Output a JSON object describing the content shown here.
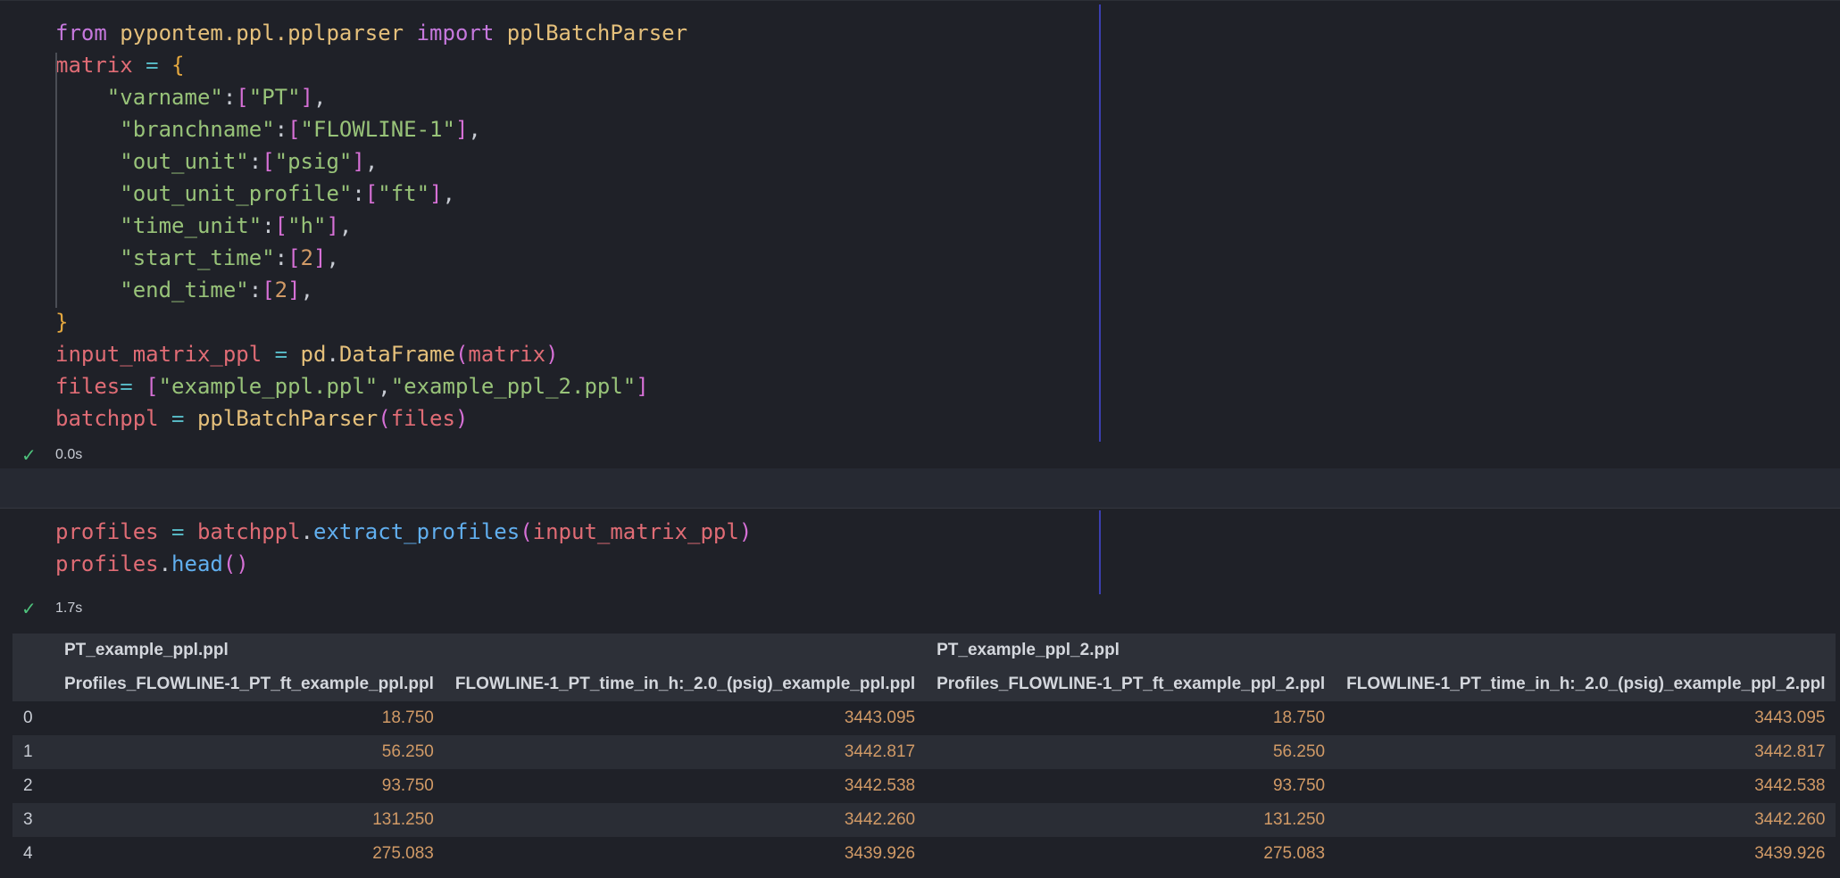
{
  "cell1": {
    "status_time": "0.0s",
    "code_lines": [
      [
        [
          "kw",
          "from "
        ],
        [
          "mod",
          "pypontem.ppl.pplparser "
        ],
        [
          "kw",
          "import "
        ],
        [
          "mod",
          "pplBatchParser"
        ]
      ],
      [
        [
          "var",
          "matrix "
        ],
        [
          "op",
          "= "
        ],
        [
          "br1",
          "{"
        ]
      ],
      [
        [
          "pun",
          "    "
        ],
        [
          "str",
          "\"varname\""
        ],
        [
          "pun",
          ":"
        ],
        [
          "br2",
          "["
        ],
        [
          "str",
          "\"PT\""
        ],
        [
          "br2",
          "]"
        ],
        [
          "pun",
          ","
        ]
      ],
      [
        [
          "pun",
          "     "
        ],
        [
          "str",
          "\"branchname\""
        ],
        [
          "pun",
          ":"
        ],
        [
          "br2",
          "["
        ],
        [
          "str",
          "\"FLOWLINE-1\""
        ],
        [
          "br2",
          "]"
        ],
        [
          "pun",
          ","
        ]
      ],
      [
        [
          "pun",
          "     "
        ],
        [
          "str",
          "\"out_unit\""
        ],
        [
          "pun",
          ":"
        ],
        [
          "br2",
          "["
        ],
        [
          "str",
          "\"psig\""
        ],
        [
          "br2",
          "]"
        ],
        [
          "pun",
          ","
        ]
      ],
      [
        [
          "pun",
          "     "
        ],
        [
          "str",
          "\"out_unit_profile\""
        ],
        [
          "pun",
          ":"
        ],
        [
          "br2",
          "["
        ],
        [
          "str",
          "\"ft\""
        ],
        [
          "br2",
          "]"
        ],
        [
          "pun",
          ","
        ]
      ],
      [
        [
          "pun",
          "     "
        ],
        [
          "str",
          "\"time_unit\""
        ],
        [
          "pun",
          ":"
        ],
        [
          "br2",
          "["
        ],
        [
          "str",
          "\"h\""
        ],
        [
          "br2",
          "]"
        ],
        [
          "pun",
          ","
        ]
      ],
      [
        [
          "pun",
          "     "
        ],
        [
          "str",
          "\"start_time\""
        ],
        [
          "pun",
          ":"
        ],
        [
          "br2",
          "["
        ],
        [
          "num",
          "2"
        ],
        [
          "br2",
          "]"
        ],
        [
          "pun",
          ","
        ]
      ],
      [
        [
          "pun",
          "     "
        ],
        [
          "str",
          "\"end_time\""
        ],
        [
          "pun",
          ":"
        ],
        [
          "br2",
          "["
        ],
        [
          "num",
          "2"
        ],
        [
          "br2",
          "]"
        ],
        [
          "pun",
          ","
        ]
      ],
      [
        [
          "br1",
          "}"
        ]
      ],
      [
        [
          "var",
          "input_matrix_ppl "
        ],
        [
          "op",
          "= "
        ],
        [
          "mod",
          "pd"
        ],
        [
          "pun",
          "."
        ],
        [
          "cls",
          "DataFrame"
        ],
        [
          "br2",
          "("
        ],
        [
          "var",
          "matrix"
        ],
        [
          "br2",
          "("
        ]
      ],
      [
        [
          "var",
          "files"
        ],
        [
          "op",
          "= "
        ],
        [
          "br2",
          "["
        ],
        [
          "str",
          "\"example_ppl.ppl\""
        ],
        [
          "pun",
          ","
        ],
        [
          "str",
          "\"example_ppl_2.ppl\""
        ],
        [
          "br2",
          "]"
        ]
      ],
      [
        [
          "var",
          "batchppl "
        ],
        [
          "op",
          "= "
        ],
        [
          "cls",
          "pplBatchParser"
        ],
        [
          "br2",
          "("
        ],
        [
          "var",
          "files"
        ],
        [
          "br2",
          ")"
        ]
      ]
    ]
  },
  "cell2": {
    "status_time": "1.7s",
    "code_lines": [
      [
        [
          "var",
          "profiles "
        ],
        [
          "op",
          "= "
        ],
        [
          "var",
          "batchppl"
        ],
        [
          "pun",
          "."
        ],
        [
          "fn",
          "extract_profiles"
        ],
        [
          "br2",
          "("
        ],
        [
          "var",
          "input_matrix_ppl"
        ],
        [
          "br2",
          ")"
        ]
      ],
      [
        [
          "var",
          "profiles"
        ],
        [
          "pun",
          "."
        ],
        [
          "fn",
          "head"
        ],
        [
          "br2",
          "()"
        ]
      ]
    ]
  },
  "table": {
    "group_headers": [
      "PT_example_ppl.ppl",
      "PT_example_ppl_2.ppl"
    ],
    "columns": [
      "Profiles_FLOWLINE-1_PT_ft_example_ppl.ppl",
      "FLOWLINE-1_PT_time_in_h:_2.0_(psig)_example_ppl.ppl",
      "Profiles_FLOWLINE-1_PT_ft_example_ppl_2.ppl",
      "FLOWLINE-1_PT_time_in_h:_2.0_(psig)_example_ppl_2.ppl"
    ],
    "rows": [
      {
        "index": "0",
        "values": [
          "18.750",
          "3443.095",
          "18.750",
          "3443.095"
        ]
      },
      {
        "index": "1",
        "values": [
          "56.250",
          "3442.817",
          "56.250",
          "3442.817"
        ]
      },
      {
        "index": "2",
        "values": [
          "93.750",
          "3442.538",
          "93.750",
          "3442.538"
        ]
      },
      {
        "index": "3",
        "values": [
          "131.250",
          "3442.260",
          "131.250",
          "3442.260"
        ]
      },
      {
        "index": "4",
        "values": [
          "275.083",
          "3439.926",
          "275.083",
          "3439.926"
        ]
      }
    ]
  },
  "colors": {
    "success_check": "#4ec27c",
    "ruler": "#3b3fb0",
    "background": "#1f2128"
  }
}
